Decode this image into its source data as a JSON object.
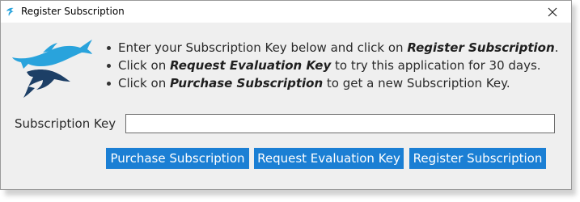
{
  "window": {
    "title": "Register Subscription",
    "close_label": "×"
  },
  "instructions": [
    {
      "before": "Enter your Subscription Key below and click on ",
      "bold": "Register Subscription",
      "after": "."
    },
    {
      "before": "Click on ",
      "bold": "Request Evaluation Key",
      "after": " to try this application for 30 days."
    },
    {
      "before": "Click on ",
      "bold": "Purchase Subscription",
      "after": " to get a new Subscription Key."
    }
  ],
  "form": {
    "key_label": "Subscription Key",
    "key_value": "",
    "key_placeholder": ""
  },
  "buttons": {
    "purchase": "Purchase Subscription",
    "evaluation": "Request Evaluation Key",
    "register": "Register Subscription"
  },
  "icons": {
    "app": "marlin-icon",
    "logo": "marlin-logo",
    "close": "close-icon"
  },
  "colors": {
    "accent": "#1b7fd4",
    "logo_light": "#29a3dc",
    "logo_dark": "#1d3f66"
  }
}
